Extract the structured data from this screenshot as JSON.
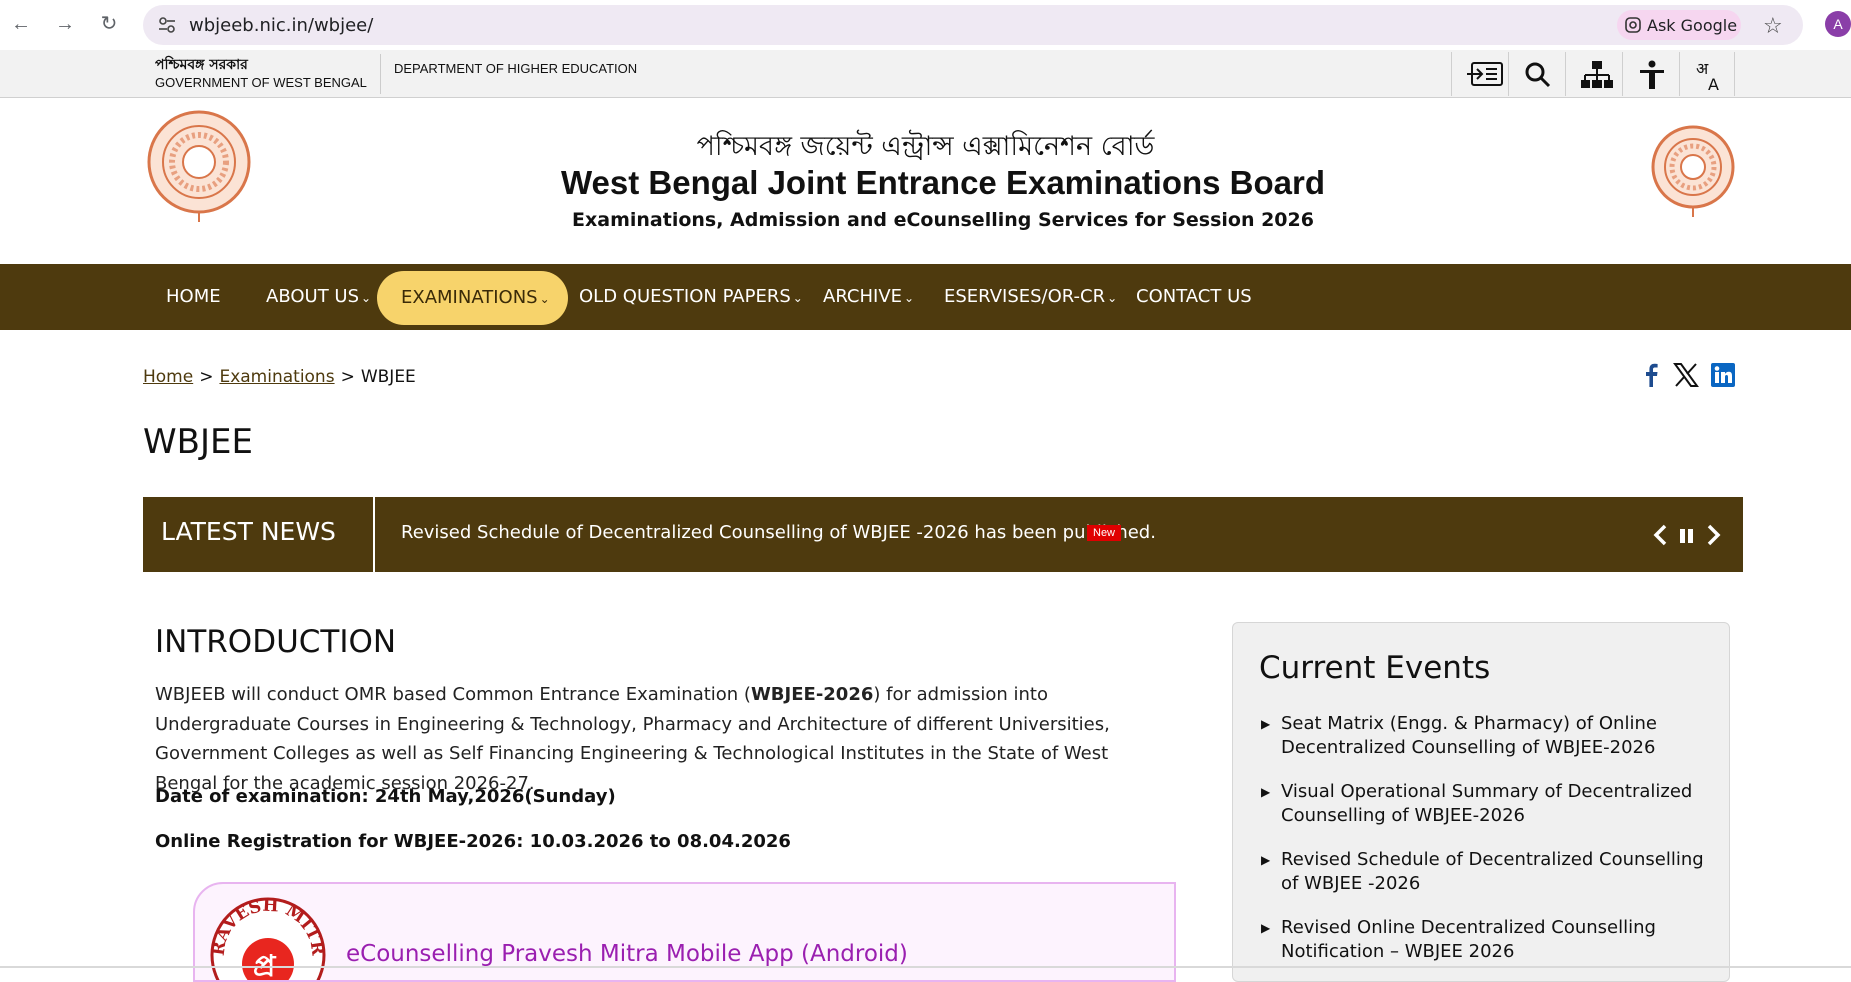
{
  "browser": {
    "url": "wbjeeb.nic.in/wbjee/",
    "ask_google": "Ask Google",
    "profile_initial": "A"
  },
  "gov_strip": {
    "state_bengali": "পশ্চিমবঙ্গ সরকার",
    "state_english": "GOVERNMENT OF WEST BENGAL",
    "department": "DEPARTMENT OF HIGHER EDUCATION",
    "tools": [
      "skip-to-content-icon",
      "search-icon",
      "sitemap-icon",
      "accessibility-icon",
      "language-icon"
    ]
  },
  "header": {
    "bengali_title": "পশ্চিমবঙ্গ জয়েন্ট এন্ট্রান্স এক্সামিনেশন বোর্ড",
    "title": "West Bengal Joint Entrance Examinations Board",
    "subtitle": "Examinations, Admission and eCounselling Services for Session 2026"
  },
  "nav": {
    "items": [
      {
        "label": "HOME",
        "has_dropdown": false
      },
      {
        "label": "ABOUT US",
        "has_dropdown": true
      },
      {
        "label": "EXAMINATIONS",
        "has_dropdown": true,
        "active": true
      },
      {
        "label": "OLD QUESTION PAPERS",
        "has_dropdown": true
      },
      {
        "label": "ARCHIVE",
        "has_dropdown": true
      },
      {
        "label": "ESERVISES/OR-CR",
        "has_dropdown": true
      },
      {
        "label": "CONTACT US",
        "has_dropdown": false
      }
    ],
    "caret": "⌄"
  },
  "breadcrumb": {
    "items": [
      "Home",
      "Examinations",
      "WBJEE"
    ],
    "separator": ">"
  },
  "social": [
    "facebook-icon",
    "x-icon",
    "linkedin-icon"
  ],
  "page_title": "WBJEE",
  "latest_news": {
    "label": "LATEST NEWS",
    "text": "Revised Schedule of Decentralized Counselling of WBJEE -2026 has been published.",
    "badge": "New"
  },
  "intro": {
    "heading": "INTRODUCTION",
    "body_before": "WBJEEB will conduct OMR based Common Entrance Examination (",
    "body_bold": "WBJEE-2026",
    "body_after": ") for admission into Undergraduate Courses in Engineering & Technology, Pharmacy and Architecture of different Universities, Government Colleges as well as Self Financing Engineering & Technological Institutes in the State of West Bengal for the academic session 2026-27.",
    "exam_date": "Date of examination: 24th May,2026(Sunday)",
    "registration": "Online Registration for WBJEE-2026: 10.03.2026 to 08.04.2026"
  },
  "app_card": {
    "logo_text": "PRAVESH MITRA",
    "link": "eCounselling Pravesh Mitra Mobile App (Android)"
  },
  "current_events": {
    "title": "Current Events",
    "items": [
      "Seat Matrix (Engg. & Pharmacy) of Online Decentralized Counselling of WBJEE-2026",
      "Visual Operational Summary of Decentralized Counselling of WBJEE-2026",
      "Revised Schedule of Decentralized Counselling of WBJEE -2026",
      "Revised Online Decentralized Counselling Notification – WBJEE 2026"
    ]
  },
  "colors": {
    "nav_bg": "#4e3a0e",
    "nav_active": "#f7d36b",
    "badge_red": "#e00000",
    "app_link": "#9a1fb0"
  }
}
